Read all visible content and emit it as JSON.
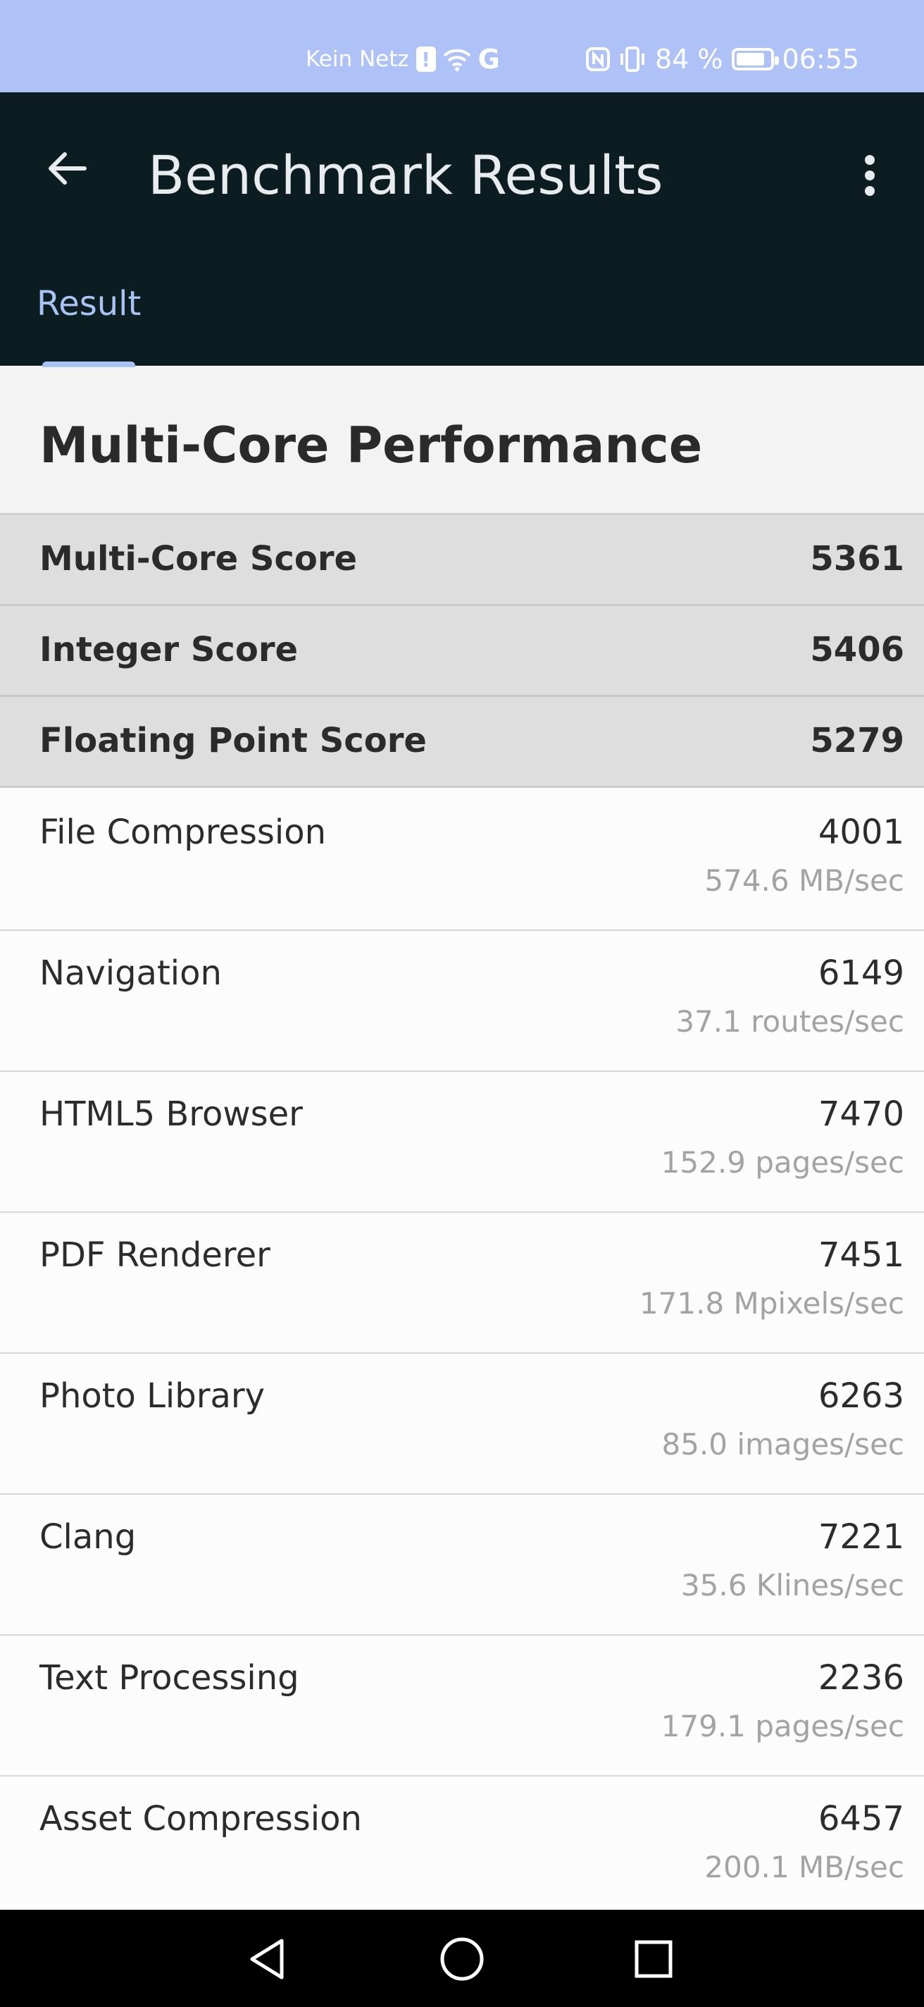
{
  "status_bar": {
    "carrier": "Kein Netz",
    "battery_percent": "84 %",
    "battery_level": 0.84,
    "time": "06:55",
    "icons": [
      "alert-icon",
      "wifi-icon",
      "g-icon",
      "nfc-icon",
      "vibrate-icon",
      "battery-icon"
    ]
  },
  "app_bar": {
    "title": "Benchmark Results",
    "tab_label": "Result"
  },
  "section": {
    "title": "Multi-Core Performance"
  },
  "scores": [
    {
      "label": "Multi-Core Score",
      "value": "5361"
    },
    {
      "label": "Integer Score",
      "value": "5406"
    },
    {
      "label": "Floating Point Score",
      "value": "5279"
    }
  ],
  "benchmarks": [
    {
      "label": "File Compression",
      "value": "4001",
      "rate": "574.6 MB/sec"
    },
    {
      "label": "Navigation",
      "value": "6149",
      "rate": "37.1 routes/sec"
    },
    {
      "label": "HTML5 Browser",
      "value": "7470",
      "rate": "152.9 pages/sec"
    },
    {
      "label": "PDF Renderer",
      "value": "7451",
      "rate": "171.8 Mpixels/sec"
    },
    {
      "label": "Photo Library",
      "value": "6263",
      "rate": "85.0 images/sec"
    },
    {
      "label": "Clang",
      "value": "7221",
      "rate": "35.6 Klines/sec"
    },
    {
      "label": "Text Processing",
      "value": "2236",
      "rate": "179.1 pages/sec"
    },
    {
      "label": "Asset Compression",
      "value": "6457",
      "rate": "200.1 MB/sec"
    }
  ],
  "colors": {
    "status_bar": "#afc2f8",
    "app_bar": "#0b1d21",
    "accent": "#a8c3f4",
    "score_row": "#dedede"
  }
}
